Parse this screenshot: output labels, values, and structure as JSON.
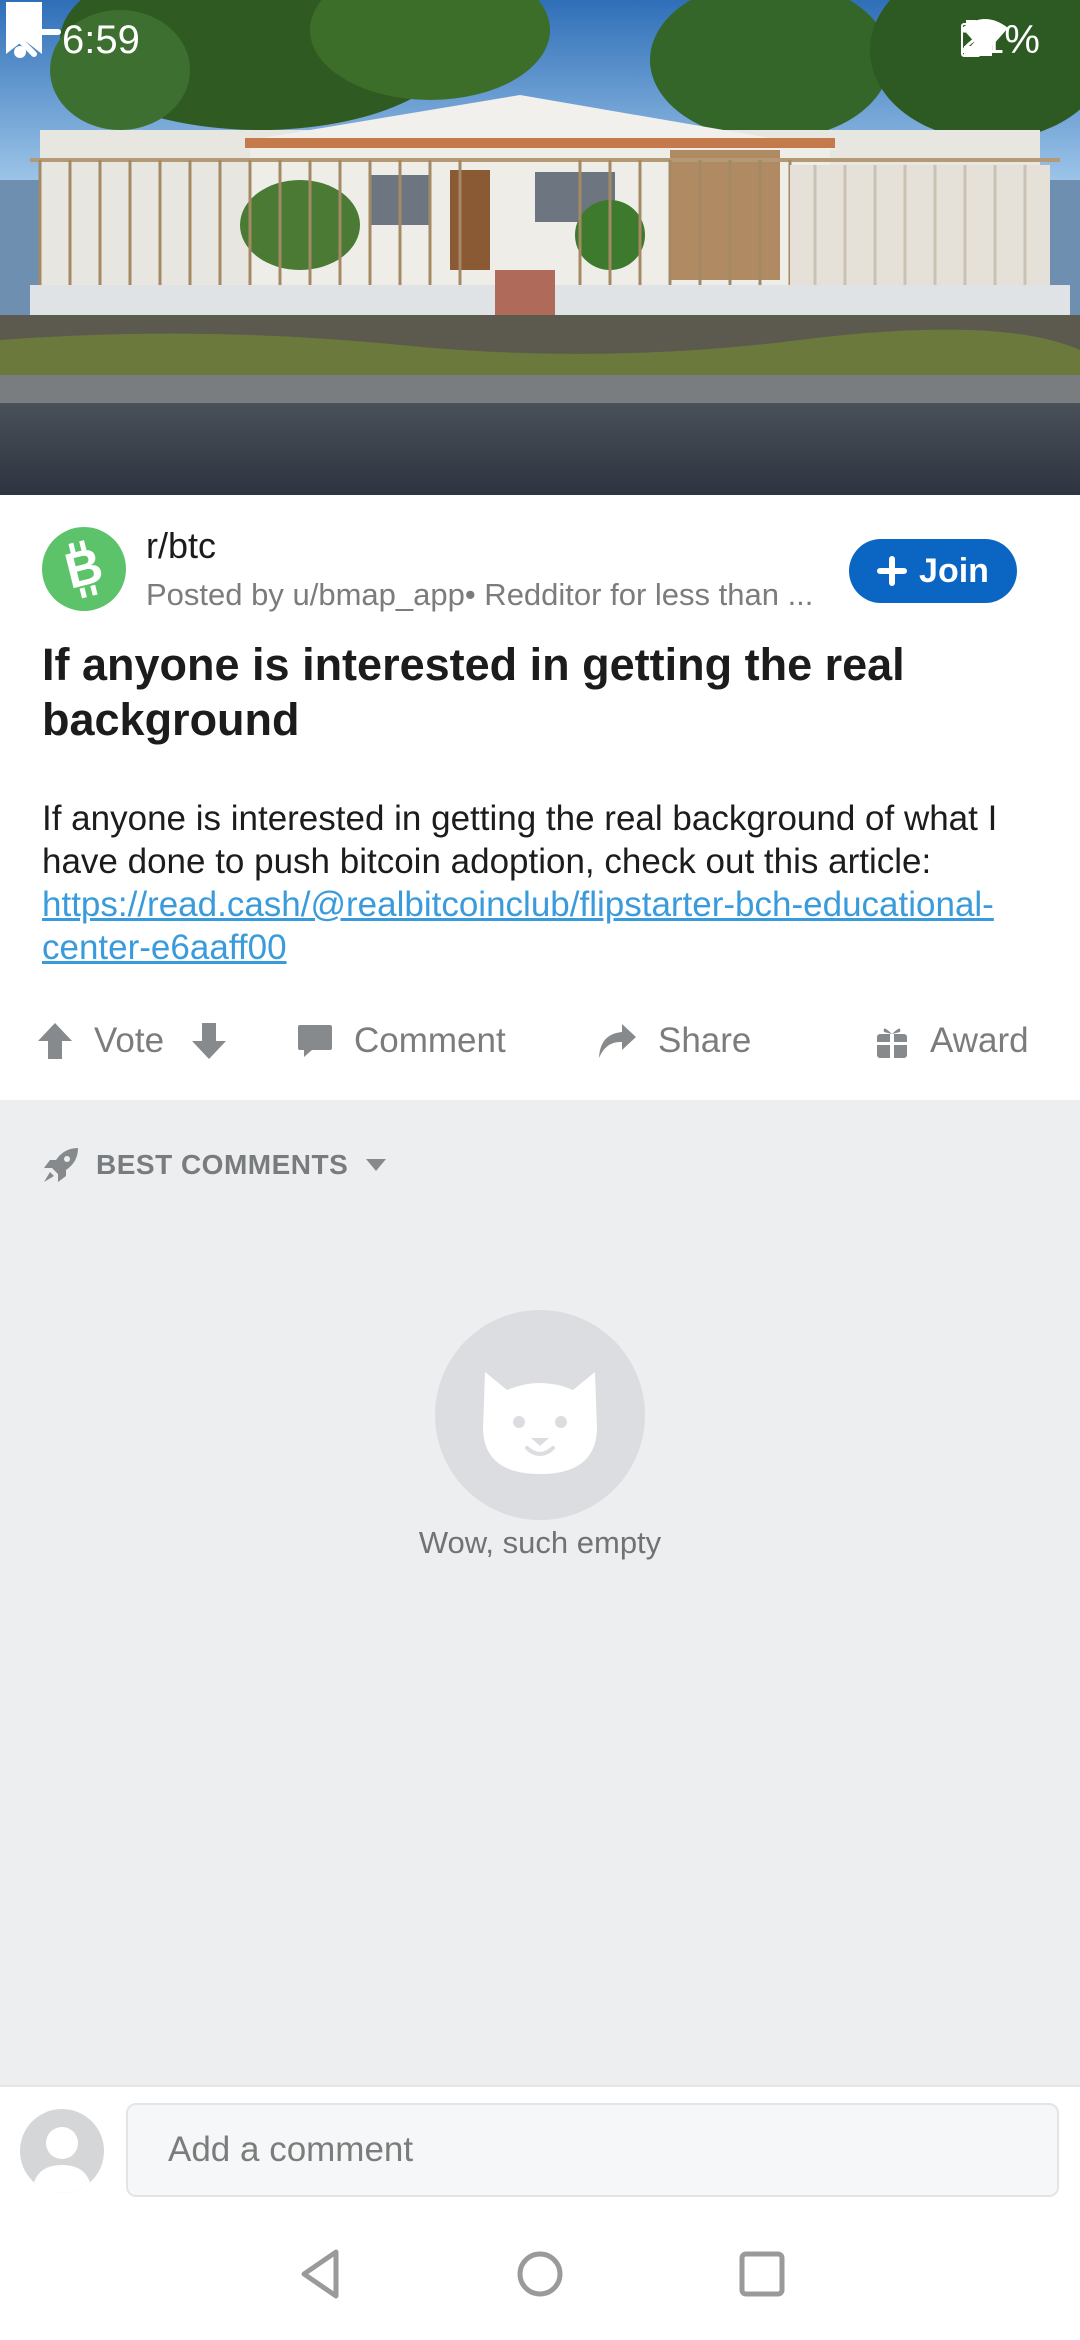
{
  "status_bar": {
    "time": "6:59",
    "battery": "21%"
  },
  "post": {
    "subreddit": "r/btc",
    "posted_by": "Posted by u/bmap_app• Redditor for less than ...",
    "join_label": "Join",
    "title": "If anyone is interested in getting the real background",
    "body_text": "If anyone is interested in getting the real background of what I have done to push bitcoin adoption, check out this article: ",
    "link_text": "https://read.cash/@realbitcoinclub/flipstarter-bch-educational-center-e6aaff00"
  },
  "actions": {
    "vote": "Vote",
    "comment": "Comment",
    "share": "Share",
    "award": "Award"
  },
  "comments": {
    "sort_label": "BEST COMMENTS",
    "empty_text": "Wow, such empty"
  },
  "comment_bar": {
    "placeholder": "Add a comment"
  },
  "colors": {
    "join_blue": "#0a66c2",
    "subreddit_green": "#5cc36b",
    "link_blue": "#3a9bdc",
    "comments_bg": "#edeef0"
  }
}
